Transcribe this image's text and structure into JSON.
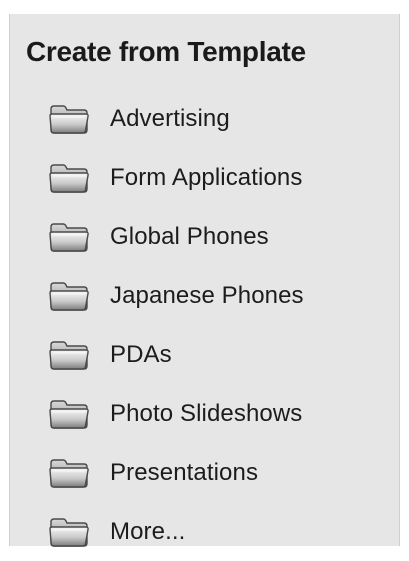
{
  "panel": {
    "title": "Create from Template",
    "items": [
      {
        "label": "Advertising",
        "icon": "folder-icon"
      },
      {
        "label": "Form Applications",
        "icon": "folder-icon"
      },
      {
        "label": "Global Phones",
        "icon": "folder-icon"
      },
      {
        "label": "Japanese Phones",
        "icon": "folder-icon"
      },
      {
        "label": "PDAs",
        "icon": "folder-icon"
      },
      {
        "label": "Photo Slideshows",
        "icon": "folder-icon"
      },
      {
        "label": "Presentations",
        "icon": "folder-icon"
      },
      {
        "label": "More...",
        "icon": "folder-icon"
      }
    ]
  },
  "colors": {
    "panel_background": "#e6e6e6",
    "text": "#1c1c1c"
  }
}
